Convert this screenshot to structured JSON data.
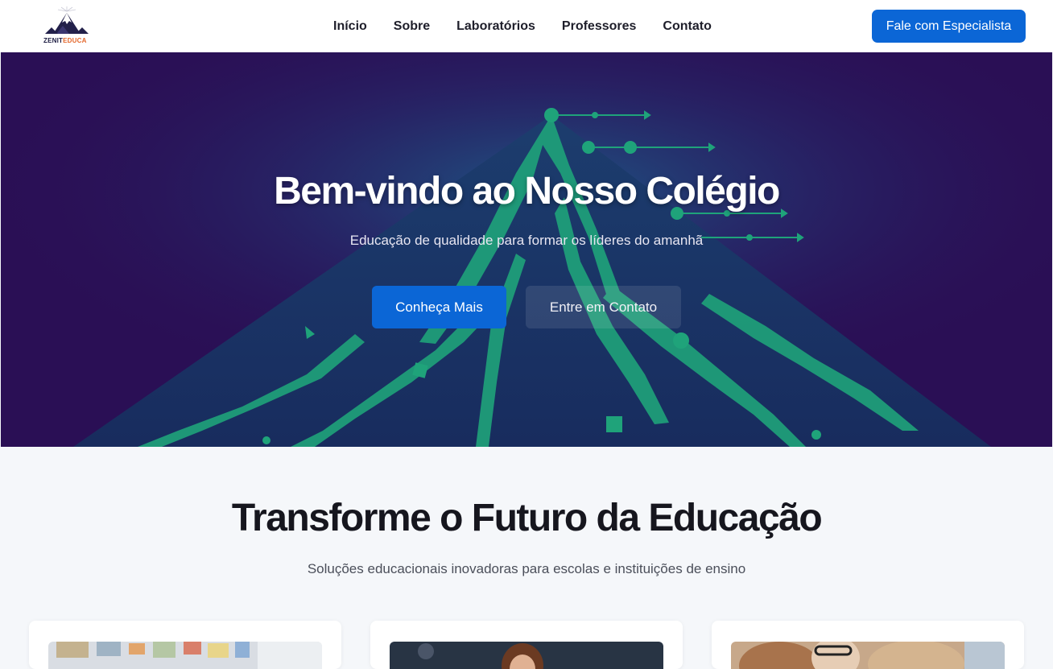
{
  "brand": {
    "name_part1": "ZENIT",
    "name_part2": "EDUCA",
    "accent": "#e3662a",
    "dark": "#1a1a40"
  },
  "nav": {
    "items": [
      {
        "label": "Início"
      },
      {
        "label": "Sobre"
      },
      {
        "label": "Laboratórios"
      },
      {
        "label": "Professores"
      },
      {
        "label": "Contato"
      }
    ],
    "cta_label": "Fale com Especialista"
  },
  "hero": {
    "title": "Bem-vindo ao Nosso Colégio",
    "subtitle": "Educação de qualidade para formar os líderes do amanhã",
    "primary_button": "Conheça Mais",
    "secondary_button": "Entre em Contato",
    "background_color": "#2a0f55",
    "accent_color": "#1fa37a"
  },
  "features": {
    "title": "Transforme o Futuro da Educação",
    "subtitle": "Soluções educacionais inovadoras para escolas e instituições de ensino",
    "cards": [
      {
        "image": "classroom-photo"
      },
      {
        "image": "teacher-photo"
      },
      {
        "image": "students-photo"
      }
    ]
  },
  "colors": {
    "primary": "#0b66d6",
    "page_bg": "#f5f7fa",
    "heading": "#16161e"
  }
}
